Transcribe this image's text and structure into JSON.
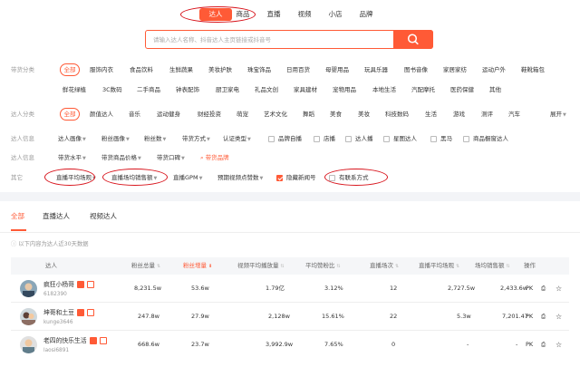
{
  "nav": {
    "tabs": [
      "达人",
      "商品",
      "直播",
      "视频",
      "小店",
      "品牌"
    ]
  },
  "search": {
    "placeholder": "请输入达人名称、抖音达人主页链接或抖音号"
  },
  "filters": {
    "category": {
      "label": "带货分类",
      "row1": [
        "全部",
        "服饰内衣",
        "食品饮料",
        "生鲜蔬果",
        "美妆护肤",
        "珠宝饰品",
        "日用百货",
        "母婴用品",
        "玩具乐器",
        "图书音像",
        "家居家纺",
        "运动户外",
        "鞋靴箱包"
      ],
      "row2": [
        "鲜花绿植",
        "3C数码",
        "二手商品",
        "钟表配饰",
        "厨卫家电",
        "礼品文创",
        "家具建材",
        "宠物用品",
        "本地生活",
        "汽配摩托",
        "医药保健",
        "其他"
      ]
    },
    "talent_category": {
      "label": "达人分类",
      "items": [
        "全部",
        "颜值达人",
        "音乐",
        "运动健身",
        "财经投资",
        "萌宠",
        "艺术文化",
        "舞蹈",
        "美食",
        "美妆",
        "科技数码",
        "生活",
        "游戏",
        "测评",
        "汽车"
      ],
      "expand": "展开"
    },
    "talent_info": {
      "label": "达人信息",
      "dropdowns": [
        "达人画像",
        "粉丝画像",
        "粉丝数",
        "带货方式",
        "认证类型"
      ],
      "checks": [
        "品牌自播",
        "店播",
        "达人播",
        "星图达人",
        "黑马",
        "商品橱窗达人"
      ]
    },
    "talent_info2": {
      "label": "达人信息",
      "dropdowns": [
        "带货水平",
        "带货商品价格",
        "带货口碑"
      ],
      "brand_link": "带货品牌"
    },
    "other": {
      "label": "其它",
      "dropdowns": [
        "直播平均场观",
        "直播场均销售额",
        "直播GPM",
        "预期视频点赞数"
      ],
      "hide_new": "隐藏新闻号",
      "has_contact": "有联系方式"
    }
  },
  "section_tabs": [
    "全部",
    "直播达人",
    "视频达人"
  ],
  "note": "以下内容为达人近30天数据",
  "table": {
    "headers": [
      "达人",
      "粉丝总量",
      "粉丝增量",
      "视频平均播放量",
      "平均赞粉比",
      "直播场次",
      "直播平均场观",
      "场均销售额",
      "操作"
    ],
    "rows": [
      {
        "name": "疯狂小杨哥",
        "id": "6182390",
        "fans": "8,231.5w",
        "growth": "53.6w",
        "avg_play": "1.79亿",
        "like_ratio": "3.12%",
        "live_count": "12",
        "avg_view": "2,727.5w",
        "avg_sales": "2,433.6w"
      },
      {
        "name": "坤哥和土豆",
        "id": "kunge3646",
        "fans": "247.8w",
        "growth": "27.9w",
        "avg_play": "2,128w",
        "like_ratio": "15.61%",
        "live_count": "22",
        "avg_view": "5.3w",
        "avg_sales": "7,201.47"
      },
      {
        "name": "老四的快乐生活",
        "id": "laosi6891",
        "fans": "668.6w",
        "growth": "23.7w",
        "avg_play": "3,992.9w",
        "like_ratio": "7.65%",
        "live_count": "0",
        "avg_view": "-",
        "avg_sales": "-"
      }
    ],
    "op_pk": "PK"
  },
  "colors": {
    "accent": "#ff5a36",
    "highlight_ring": "#d8141c"
  }
}
